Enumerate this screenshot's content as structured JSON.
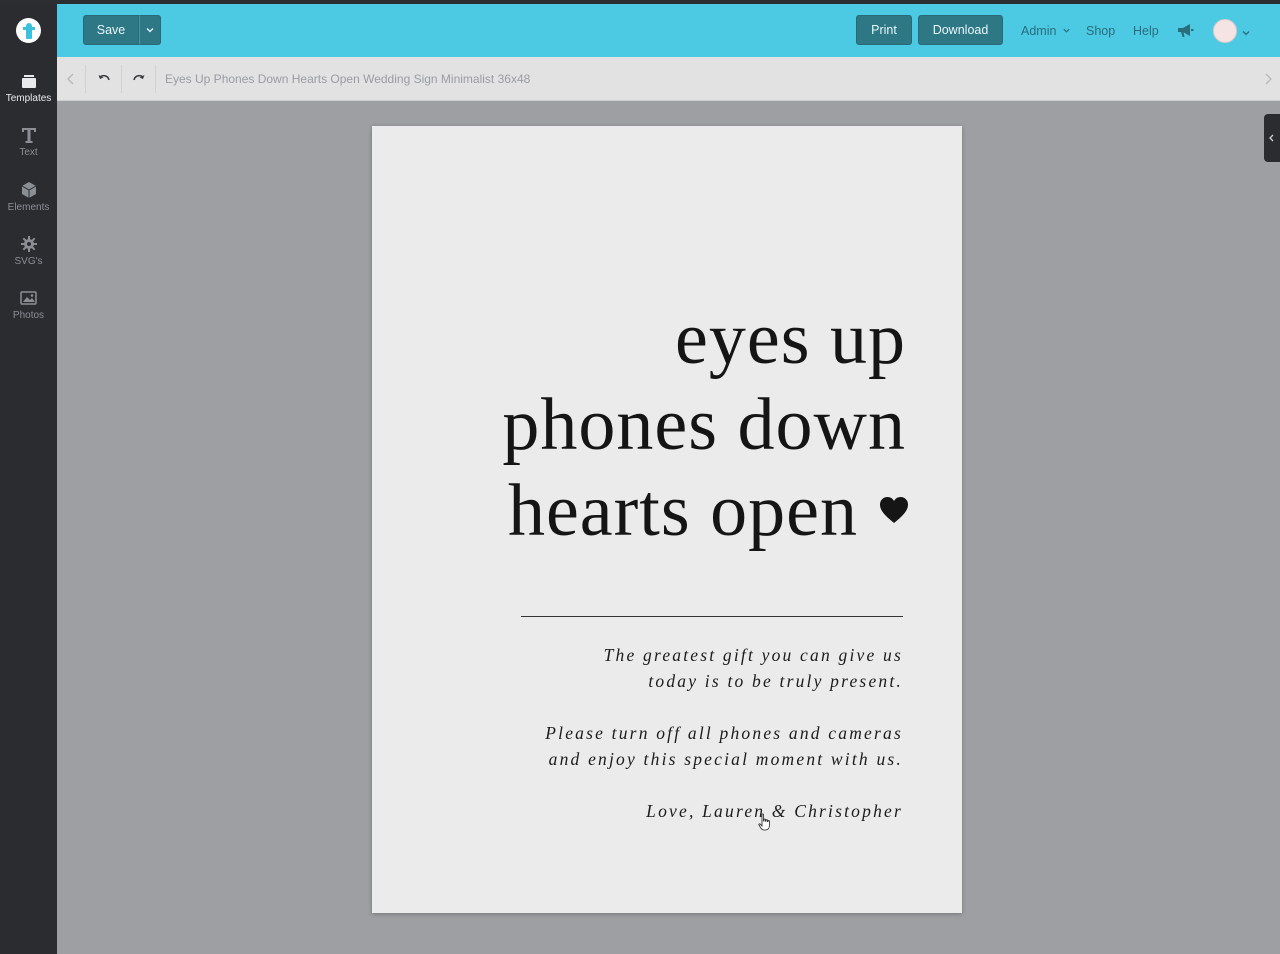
{
  "sidebar": {
    "items": [
      {
        "label": "Templates",
        "icon": "templates-icon",
        "active": true
      },
      {
        "label": "Text",
        "icon": "text-icon",
        "active": false
      },
      {
        "label": "Elements",
        "icon": "elements-icon",
        "active": false
      },
      {
        "label": "SVG's",
        "icon": "gear-icon",
        "active": false
      },
      {
        "label": "Photos",
        "icon": "photos-icon",
        "active": false
      }
    ]
  },
  "topbar": {
    "save_label": "Save",
    "print_label": "Print",
    "download_label": "Download",
    "admin_label": "Admin",
    "shop_label": "Shop",
    "help_label": "Help",
    "accent": "#4cc9e3"
  },
  "toolbar": {
    "doc_title": "Eyes Up Phones Down Hearts Open Wedding Sign Minimalist 36x48"
  },
  "sign": {
    "headline": [
      "eyes up",
      "phones down",
      "hearts open"
    ],
    "message1": [
      "The greatest gift you can give us",
      "today is to be truly present."
    ],
    "message2": [
      "Please turn off all phones and cameras",
      "and enjoy this special moment with us."
    ],
    "signature": "Love, Lauren & Christopher"
  }
}
